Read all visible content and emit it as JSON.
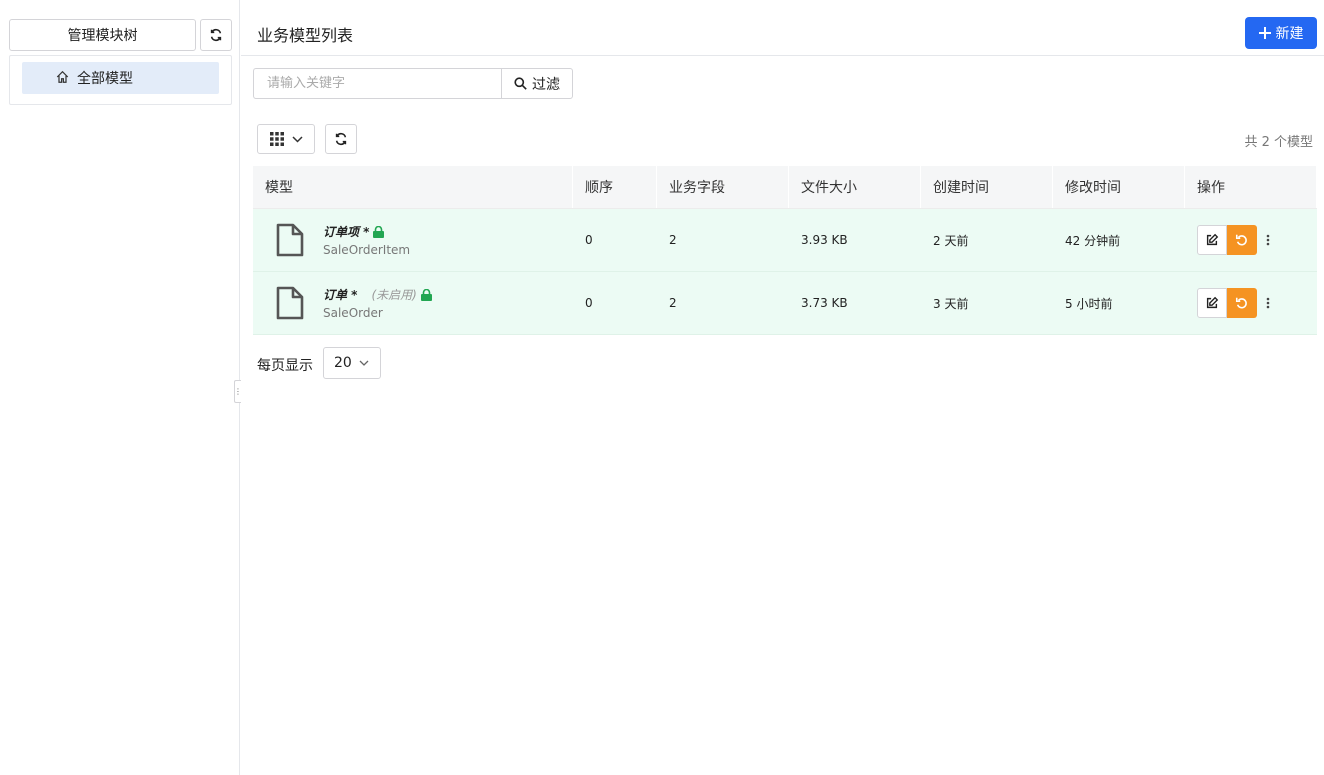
{
  "sidebar": {
    "tree_button_label": "管理模块树",
    "items": [
      {
        "label": "全部模型",
        "icon": "home-icon",
        "selected": true
      }
    ]
  },
  "header": {
    "title": "业务模型列表",
    "new_button_label": "新建"
  },
  "search": {
    "placeholder": "请输入关键字",
    "value": "",
    "filter_label": "过滤"
  },
  "toolbar": {
    "count_text": "共 2 个模型"
  },
  "table": {
    "columns": [
      "模型",
      "顺序",
      "业务字段",
      "文件大小",
      "创建时间",
      "修改时间",
      "操作"
    ],
    "rows": [
      {
        "name": "订单项 *",
        "disabled_label": "",
        "code": "SaleOrderItem",
        "order": "0",
        "fields": "2",
        "size": "3.93 KB",
        "created": "2 天前",
        "modified": "42 分钟前",
        "locked": true
      },
      {
        "name": "订单 *",
        "disabled_label": "(未启用)",
        "code": "SaleOrder",
        "order": "0",
        "fields": "2",
        "size": "3.73 KB",
        "created": "3 天前",
        "modified": "5 小时前",
        "locked": true
      }
    ]
  },
  "pager": {
    "label": "每页显示",
    "page_size": "20"
  },
  "colors": {
    "primary": "#2468f2",
    "warning": "#f59322",
    "lock": "#22a652",
    "row_bg": "#ecfbf4",
    "selected_bg": "#e3ecf9"
  }
}
